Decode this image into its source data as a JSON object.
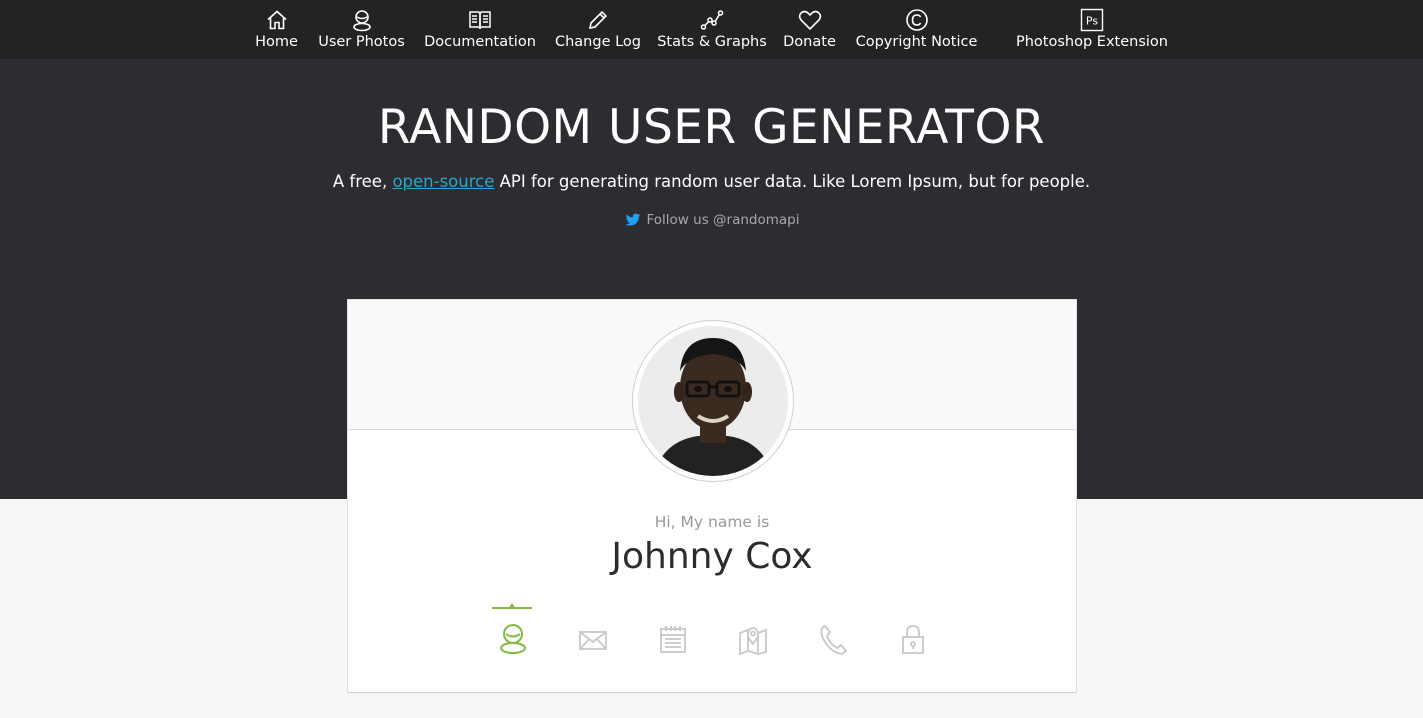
{
  "nav": {
    "items": [
      {
        "label": "Home",
        "icon": "home-icon"
      },
      {
        "label": "User Photos",
        "icon": "user-icon"
      },
      {
        "label": "Documentation",
        "icon": "book-icon"
      },
      {
        "label": "Change Log",
        "icon": "pencil-icon"
      },
      {
        "label": "Stats & Graphs",
        "icon": "graph-icon"
      },
      {
        "label": "Donate",
        "icon": "heart-icon"
      },
      {
        "label": "Copyright Notice",
        "icon": "copyright-icon"
      },
      {
        "label": "Photoshop Extension",
        "icon": "photoshop-icon",
        "icon_text": "Ps"
      }
    ]
  },
  "hero": {
    "title": "RANDOM USER GENERATOR",
    "sub_prefix": "A free, ",
    "sub_link": "open-source",
    "sub_suffix": " API for generating random user data. Like Lorem Ipsum, but for people.",
    "follow": "Follow us @randomapi"
  },
  "card": {
    "greeting": "Hi, My name is",
    "name": "Johnny Cox",
    "tabs": [
      {
        "icon": "user-icon",
        "active": true
      },
      {
        "icon": "envelope-icon",
        "active": false
      },
      {
        "icon": "calendar-icon",
        "active": false
      },
      {
        "icon": "map-icon",
        "active": false
      },
      {
        "icon": "phone-icon",
        "active": false
      },
      {
        "icon": "lock-icon",
        "active": false
      }
    ]
  },
  "colors": {
    "nav_bg": "#232323",
    "hero_bg": "#2c2d31",
    "link": "#2ba6cb",
    "twitter": "#1da1f2",
    "accent": "#83ba43",
    "inactive_icon": "#c8c8c8"
  }
}
